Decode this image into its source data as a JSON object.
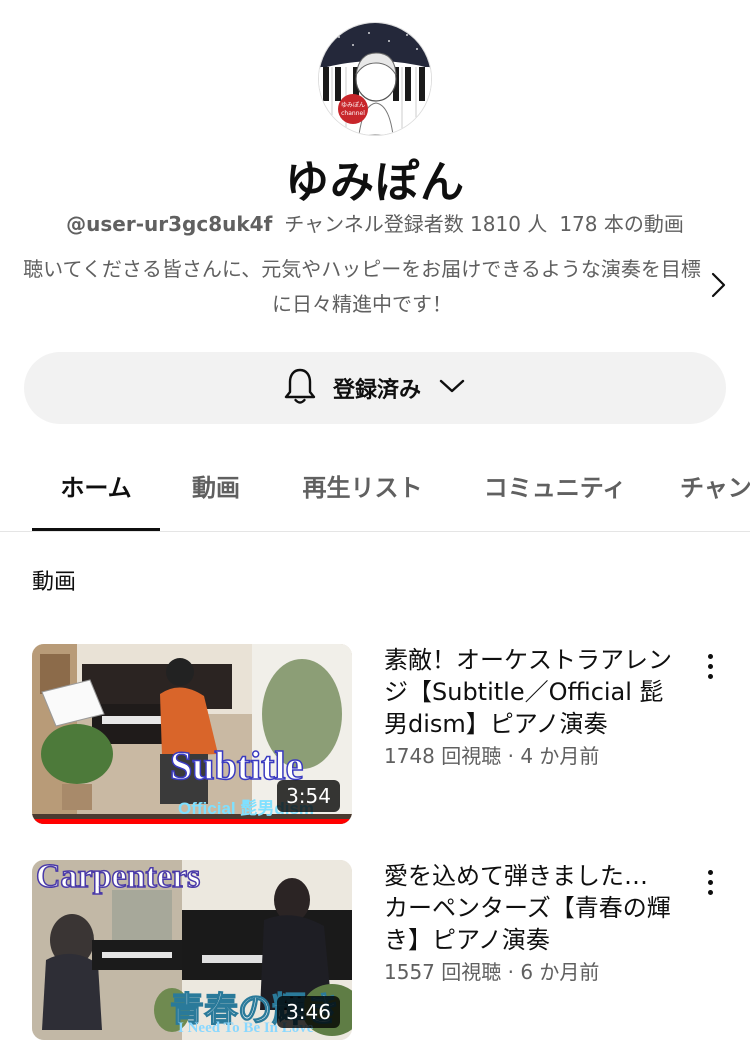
{
  "channel": {
    "name": "ゆみぽん",
    "handle": "@user-ur3gc8uk4f",
    "subscribers": "チャンネル登録者数 1810 人",
    "video_count": "178 本の動画",
    "avatar_text": "ゆみぽん channel",
    "description": "聴いてくださる皆さんに、元気やハッピーをお届けできるような演奏を目標に日々精進中です！"
  },
  "subscribe": {
    "label": "登録済み",
    "bell_icon": "bell-icon",
    "chevron_icon": "chevron-down-icon"
  },
  "tabs": [
    {
      "label": "ホーム",
      "active": true
    },
    {
      "label": "動画",
      "active": false
    },
    {
      "label": "再生リスト",
      "active": false
    },
    {
      "label": "コミュニティ",
      "active": false
    },
    {
      "label": "チャンネル",
      "active": false
    }
  ],
  "section": {
    "title": "動画"
  },
  "videos": [
    {
      "title": "素敵！オーケストラアレンジ【Subtitle／Official 髭男dism】ピアノ演奏",
      "views": "1748 回視聴",
      "age": "4 か月前",
      "meta_sep": " · ",
      "duration": "3:54",
      "overlay_main": "Subtitle",
      "overlay_sub": "Official 髭男dism",
      "watched_fraction": 1.0
    },
    {
      "title": "愛を込めて弾きました… カーペンターズ【青春の輝き】ピアノ演奏",
      "views": "1557 回視聴",
      "age": "6 か月前",
      "meta_sep": " · ",
      "duration": "3:46",
      "overlay_main": "Carpenters",
      "overlay_jp": "青春の輝き",
      "overlay_sub": "I Need To Be In Love"
    }
  ],
  "colors": {
    "text_primary": "#0f0f0f",
    "text_secondary": "#606060",
    "button_bg": "#f2f2f2",
    "progress_red": "#ff0000"
  }
}
